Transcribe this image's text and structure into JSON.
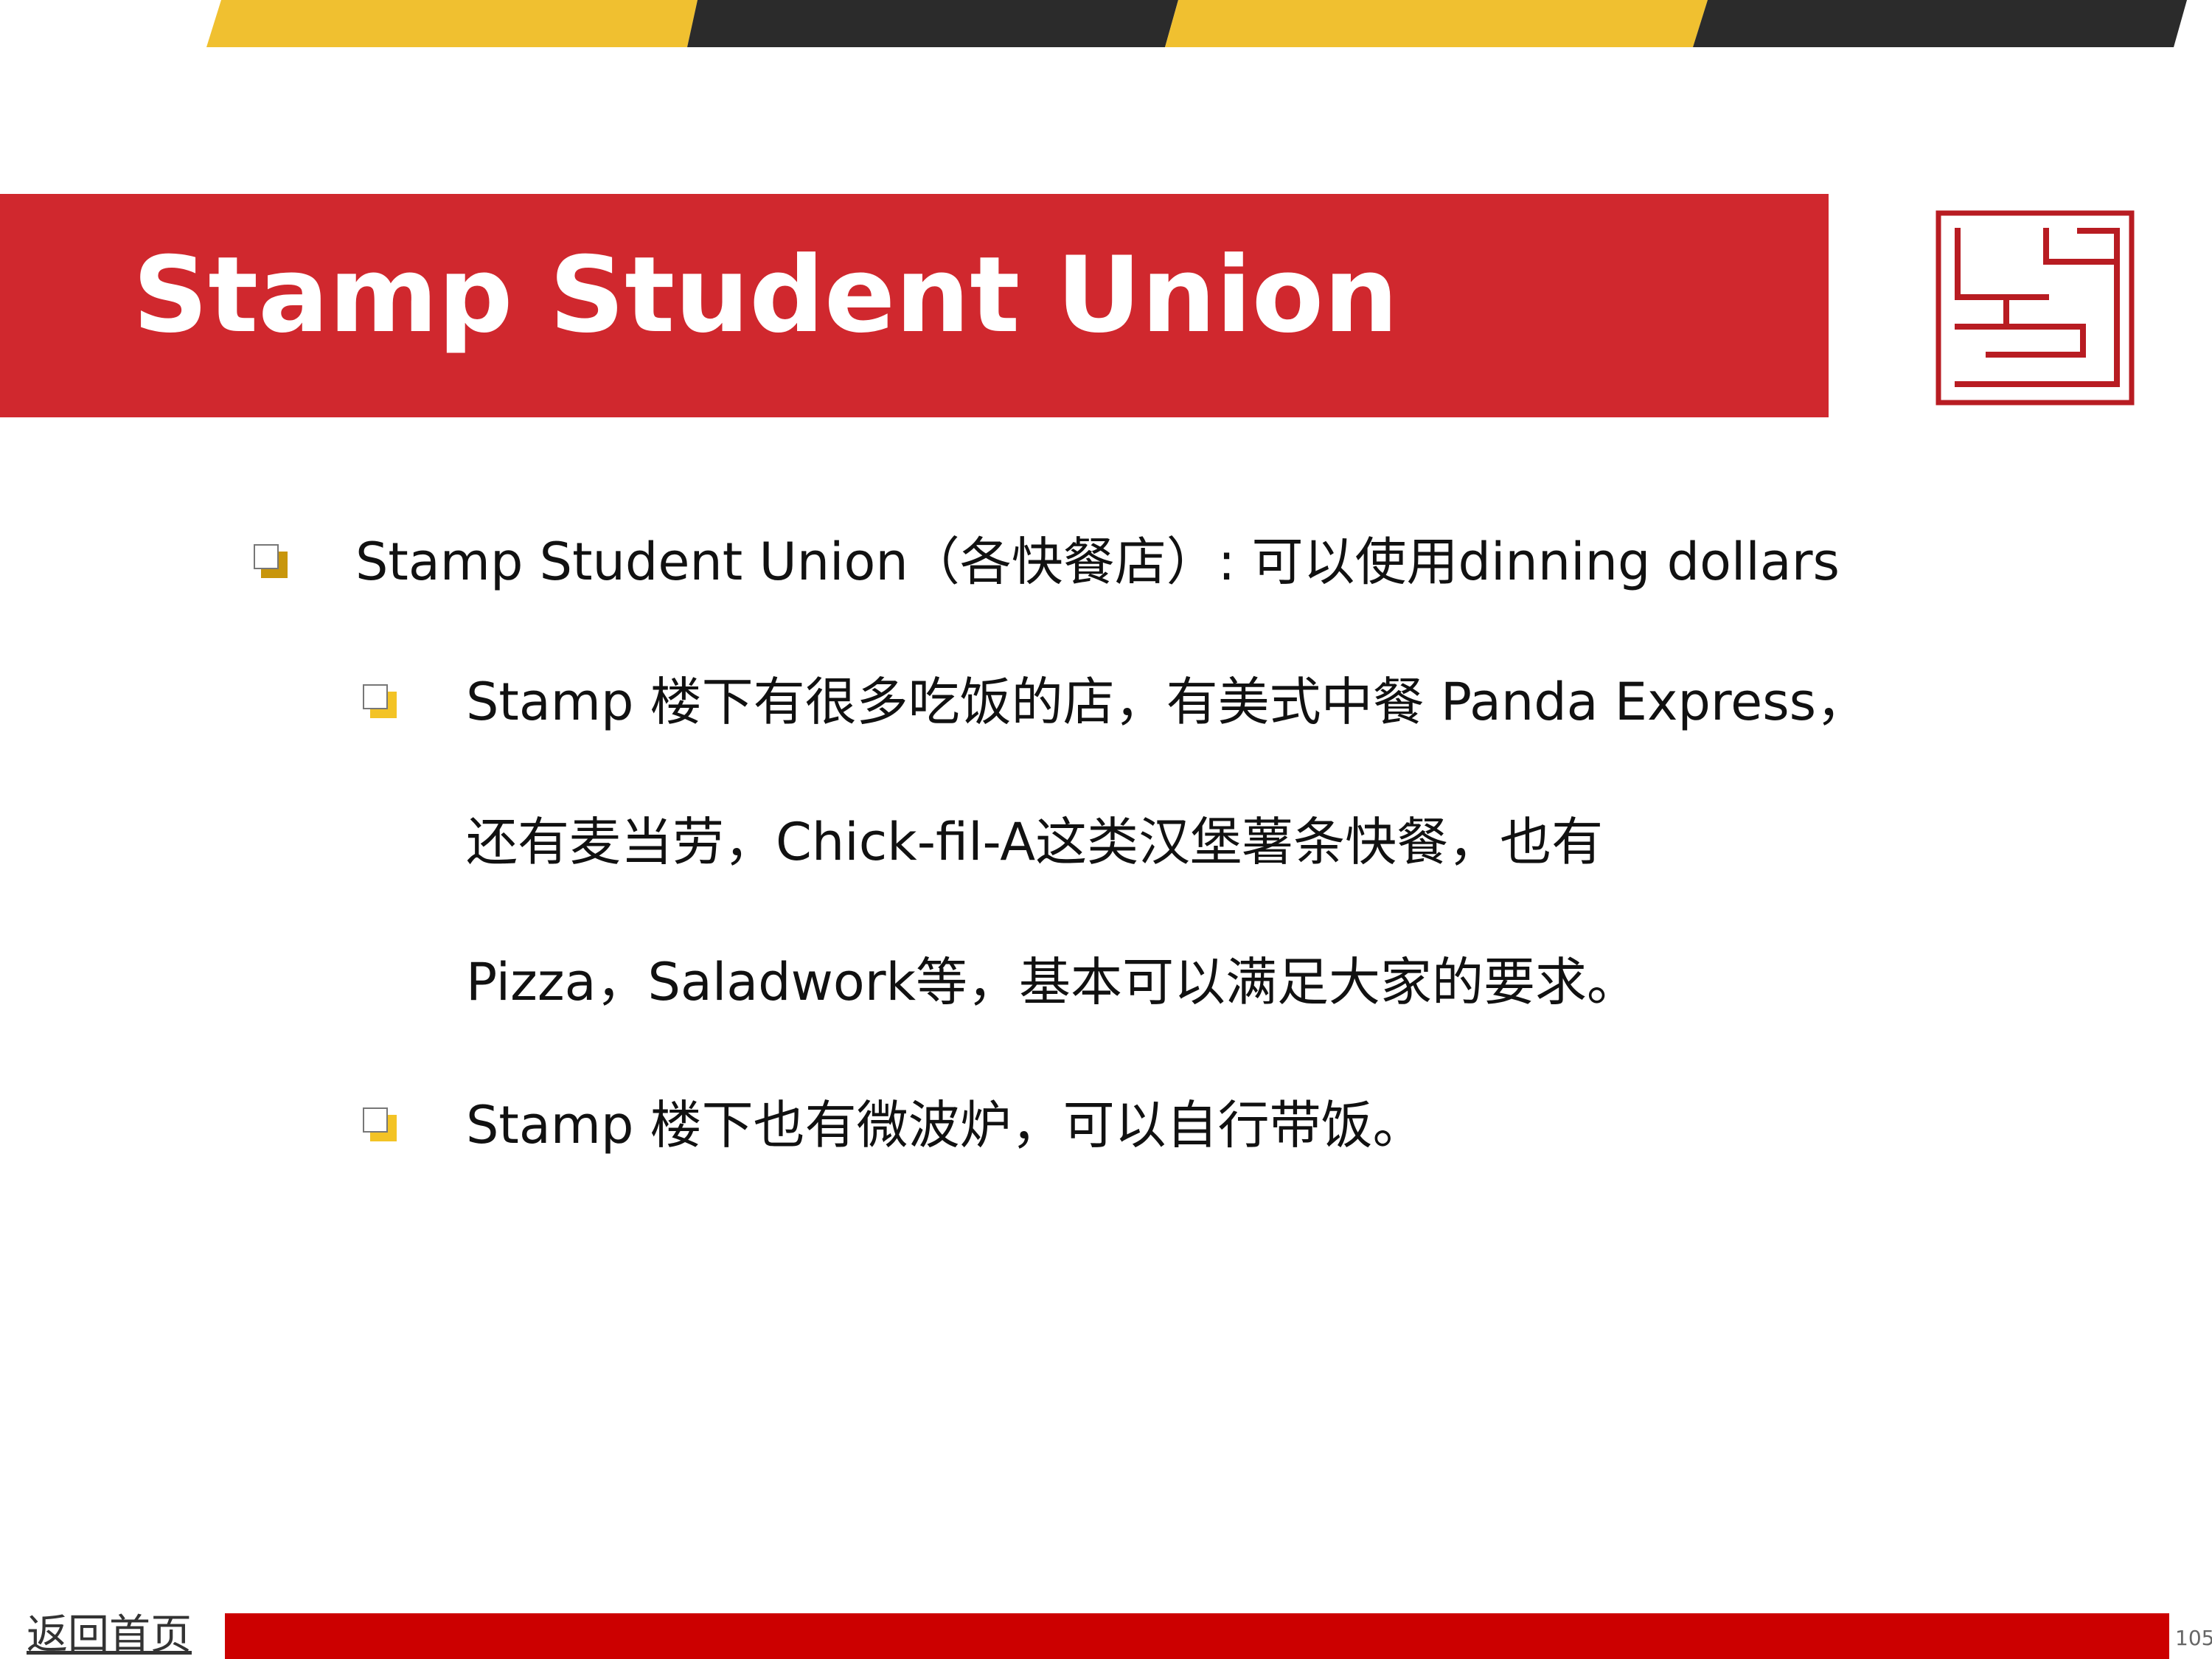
{
  "slide": {
    "title": "Stamp Student Union",
    "colors": {
      "title_banner": "#d0282e",
      "stripe_yellow": "#f0c030",
      "stripe_dark": "#2b2b2b",
      "bottom_bar": "#cc0000",
      "seal": "#b81c22",
      "bullet_level1": "#c8960c",
      "bullet_level2": "#f3c325"
    },
    "logo": {
      "icon": "maze-seal-logo"
    },
    "bullets": [
      {
        "level": 1,
        "text": "Stamp Student Union（各快餐店）: 可以使用dinning dollars"
      },
      {
        "level": 2,
        "text": "Stamp 楼下有很多吃饭的店，有美式中餐 Panda Express，"
      },
      {
        "level": 2,
        "continuation": true,
        "text": "还有麦当劳，Chick-fil-A这类汉堡薯条快餐，也有"
      },
      {
        "level": 2,
        "continuation": true,
        "text": "Pizza，Saladwork等，基本可以满足大家的要求。"
      },
      {
        "level": 2,
        "text": "Stamp 楼下也有微波炉，可以自行带饭。"
      }
    ]
  },
  "footer": {
    "home_link": "返回首页",
    "page_number": "105"
  }
}
